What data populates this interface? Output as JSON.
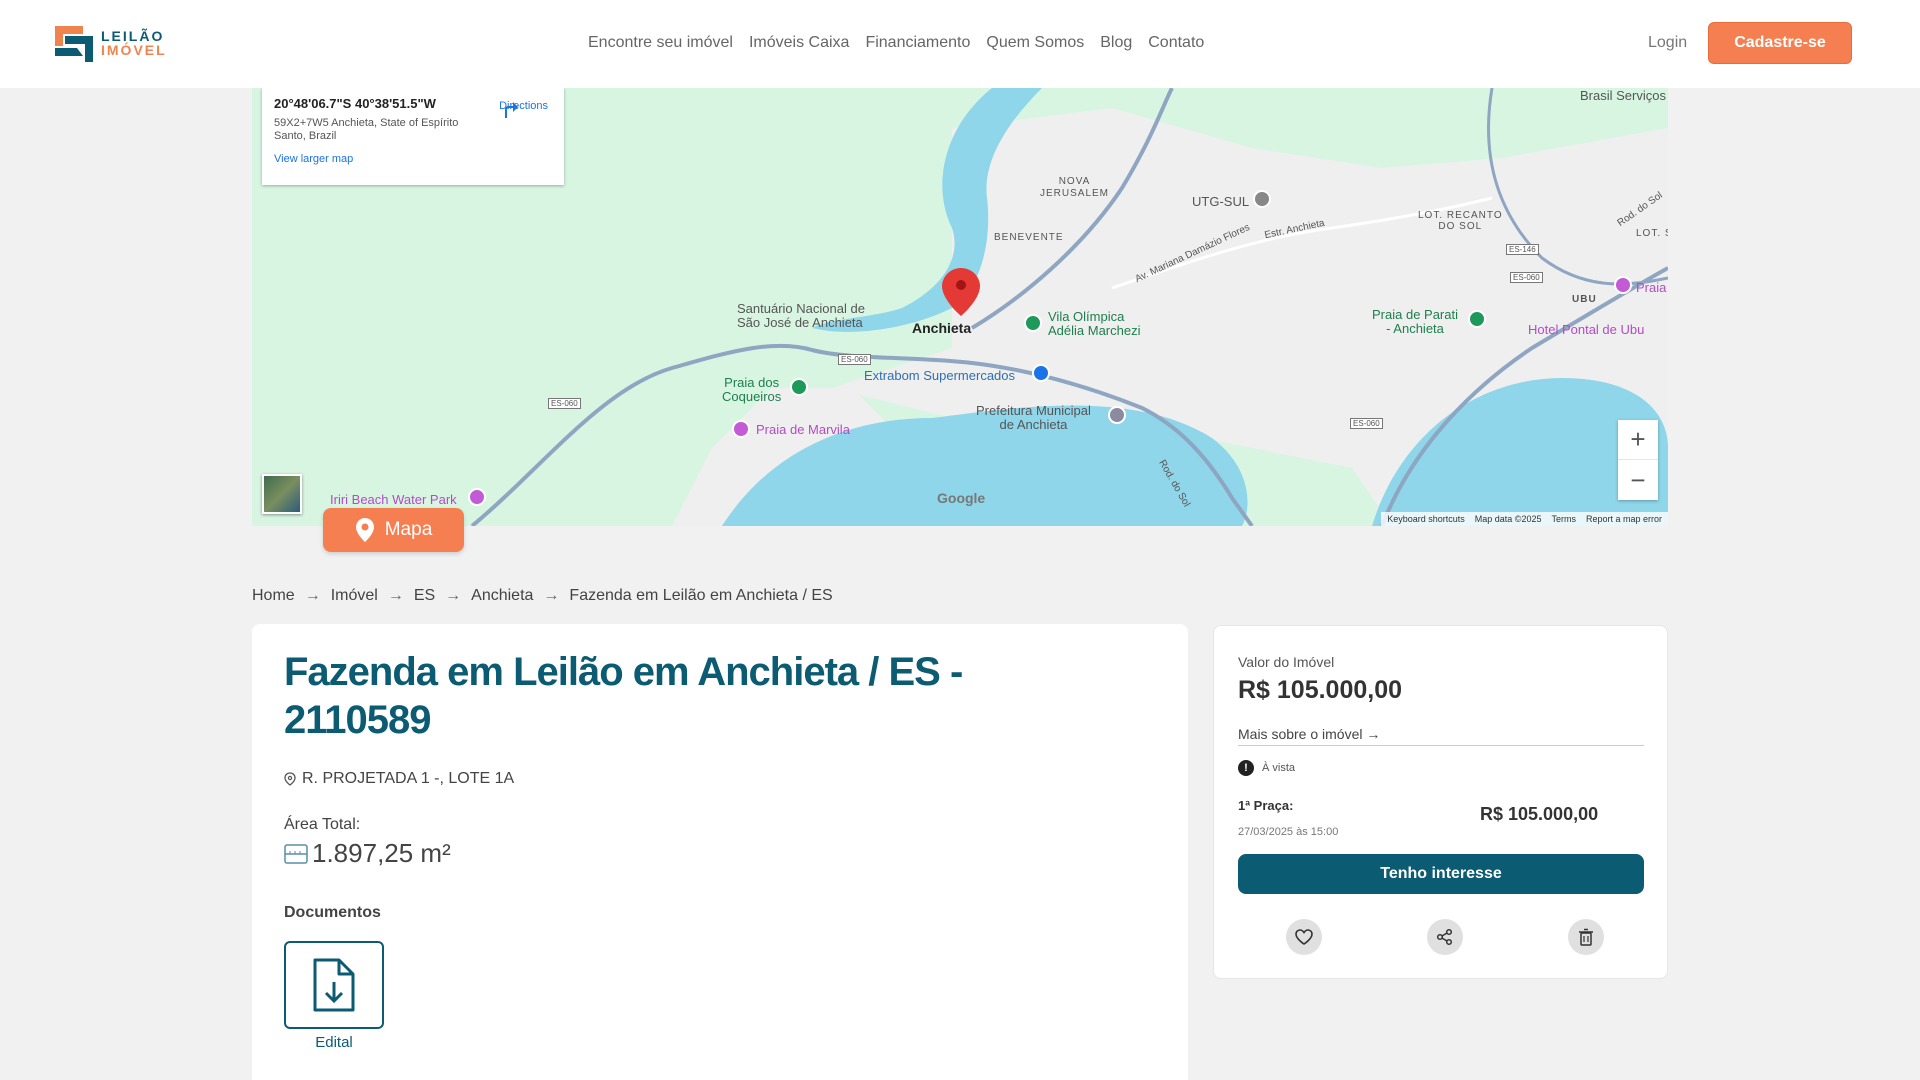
{
  "brand": {
    "line1": "LEILÃO",
    "line2": "IMÓVEL"
  },
  "nav": [
    {
      "label": "Encontre seu imóvel"
    },
    {
      "label": "Imóveis Caixa"
    },
    {
      "label": "Financiamento"
    },
    {
      "label": "Quem Somos"
    },
    {
      "label": "Blog"
    },
    {
      "label": "Contato"
    }
  ],
  "header": {
    "login": "Login",
    "signup": "Cadastre-se"
  },
  "map": {
    "coords": "20°48'06.7\"S 40°38'51.5\"W",
    "address": "59X2+7W5 Anchieta, State of Espírito Santo, Brazil",
    "larger_link": "View larger map",
    "directions": "Directions",
    "google": "Google",
    "attrib": [
      "Keyboard shortcuts",
      "Map data ©2025",
      "Terms",
      "Report a map error"
    ],
    "labels": {
      "anchieta": "Anchieta",
      "santuario": "Santuário Nacional de\nSão José de Anchieta",
      "nova_jerusalem": "NOVA\nJERUSALEM",
      "benevente": "BENEVENTE",
      "utg": "UTG-SUL",
      "recanto": "LOT. RECANTO\nDO SOL",
      "ubu": "UBU",
      "lot_s": "LOT. S",
      "praia_parati": "Praia de Parati\n- Anchieta",
      "hotel": "Hotel Pontal de Ubu",
      "praia": "Praia",
      "brasil": "Brasil Serviços",
      "vila": "Vila Olímpica\nAdélia Marchezi",
      "extrabom": "Extrabom Supermercados",
      "prefeitura": "Prefeitura Municipal\nde Anchieta",
      "coqueiros": "Praia dos\nCoqueiros",
      "marvila": "Praia de Marvila",
      "iriri": "Iriri Beach Water Park",
      "av_mariana": "Av. Mariana Damázio Flores",
      "estr_anchieta": "Estr. Anchieta",
      "rod_sol": "Rod. do Sol",
      "rod_sol2": "Rod. do Sol",
      "es060a": "ES-060",
      "es060b": "ES-060",
      "es060c": "ES-060",
      "es060d": "ES-060",
      "es146": "ES-146"
    }
  },
  "map_button": "Mapa",
  "breadcrumb": [
    "Home",
    "Imóvel",
    "ES",
    "Anchieta",
    "Fazenda em Leilão em Anchieta / ES"
  ],
  "property": {
    "title": "Fazenda em Leilão em Anchieta / ES - 2110589",
    "address": "R. PROJETADA 1 -, LOTE 1A",
    "area_label": "Área Total:",
    "area_value": "1.897,25 m²",
    "documents_label": "Documentos",
    "document_name": "Edital"
  },
  "pricing": {
    "value_label": "Valor do Imóvel",
    "value": "R$ 105.000,00",
    "more": "Mais sobre o imóvel →",
    "cash_icon": "!",
    "cash": "À vista",
    "praca_label": "1ª Praça:",
    "praca_date": "27/03/2025 às 15:00",
    "praca_value": "R$ 105.000,00",
    "cta": "Tenho interesse"
  },
  "colors": {
    "brand_teal": "#0b5b73",
    "brand_orange": "#f57f50"
  }
}
